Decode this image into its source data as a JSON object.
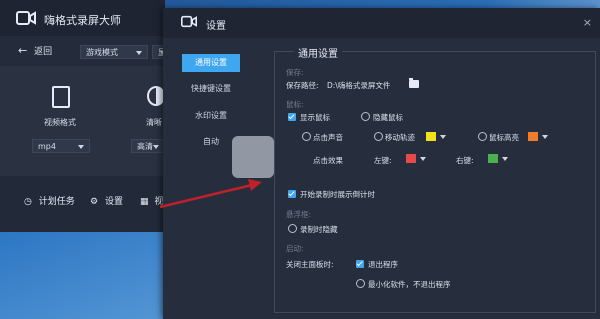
{
  "main_window": {
    "title": "嗨格式录屏大师",
    "back_label": "返回",
    "mode_select": "游戏模式",
    "second_select": "显",
    "video_format_label": "视频格式",
    "video_format_value": "mp4",
    "clarity_label": "清晰",
    "clarity_value": "高清",
    "bottom": {
      "schedule_label": "计划任务",
      "settings_label": "设置",
      "more_label": "视"
    }
  },
  "settings": {
    "title": "设置",
    "nav": [
      "通用设置",
      "快捷键设置",
      "水印设置",
      "自动"
    ],
    "panel_title": "通用设置",
    "save_section": "保存:",
    "save_path_label": "保存路径:",
    "save_path_value": "D:\\嗨格式录屏文件",
    "mouse_section": "鼠标:",
    "show_mouse": "显示鼠标",
    "hide_mouse": "隐藏鼠标",
    "click_sound": "点击声音",
    "move_trail": "移动轨迹",
    "mouse_highlight": "鼠标高亮",
    "click_effect": "点击效果",
    "left_key": "左键:",
    "right_key": "右键:",
    "countdown": "开始录制时展示倒计时",
    "floating_section": "悬浮框:",
    "hide_on_record": "录制时隐藏",
    "startup_section": "启动:",
    "close_main_label": "关闭主面板时:",
    "exit_program": "退出程序",
    "minimize_option": "最小化软件，不退出程序"
  },
  "colors": {
    "accent": "#3fa6f0",
    "trail_color": "#f2e21a",
    "highlight_color": "#f07b28",
    "left_color": "#e84a4a",
    "right_color": "#4caf50",
    "arrow": "#c0202a"
  },
  "icons": {
    "close": "×"
  }
}
